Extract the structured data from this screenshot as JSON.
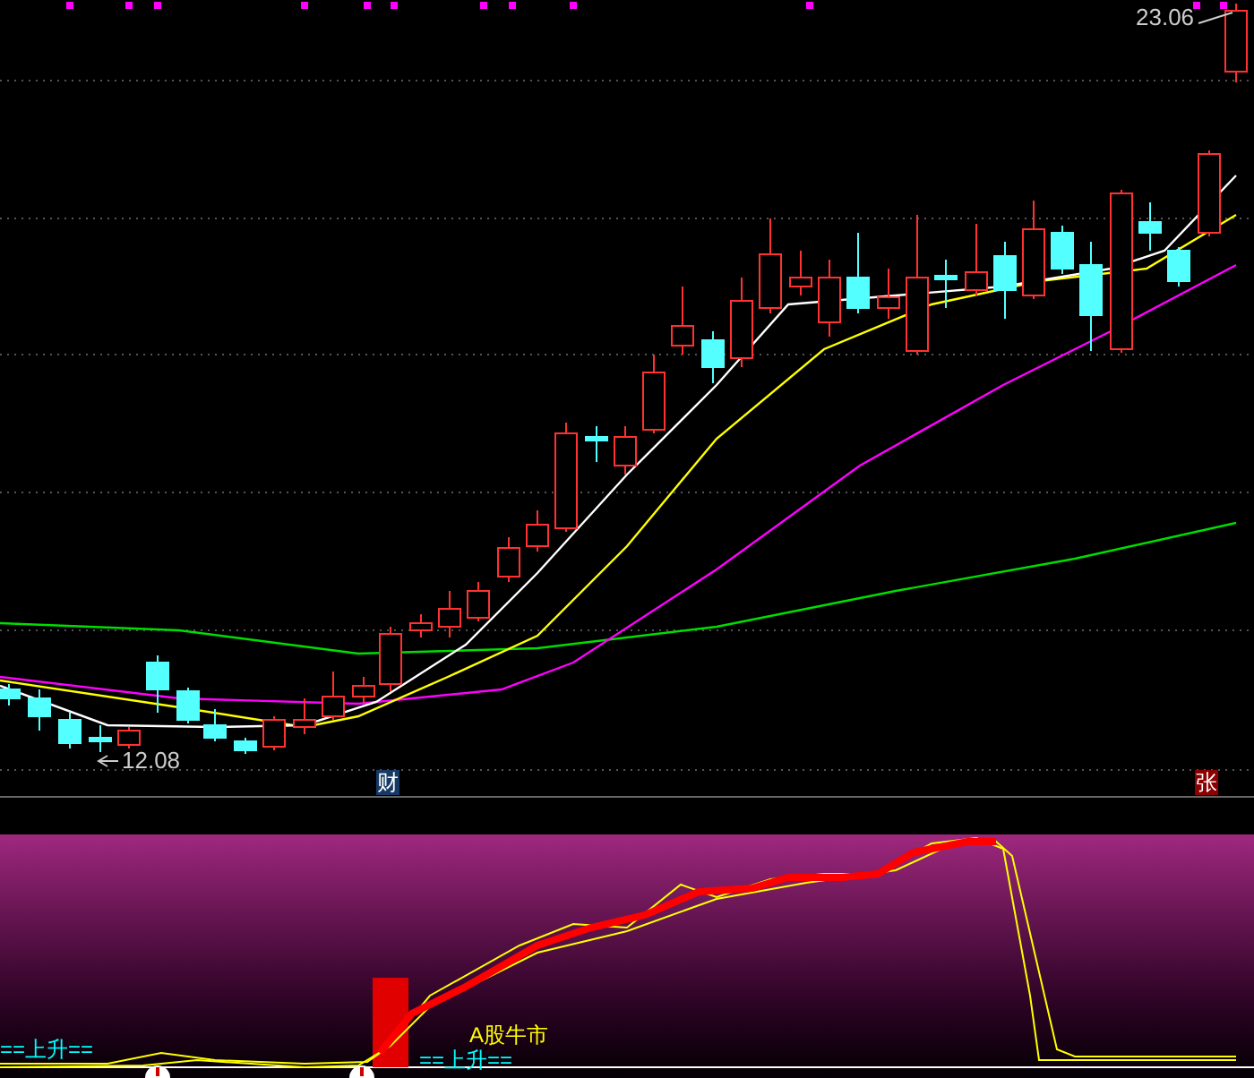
{
  "price_panel": {
    "high_label": "23.06",
    "low_label": "12.08",
    "badges": [
      {
        "text": "财",
        "color": "#163a63"
      },
      {
        "text": "张",
        "color": "#8b0000"
      }
    ]
  },
  "indicator_panel": {
    "labels": [
      {
        "text": "==上升==",
        "color": "#00ffff"
      },
      {
        "text": "==上升==",
        "color": "#00ffff"
      },
      {
        "text": "A股牛市",
        "color": "#ffff00"
      }
    ]
  }
}
